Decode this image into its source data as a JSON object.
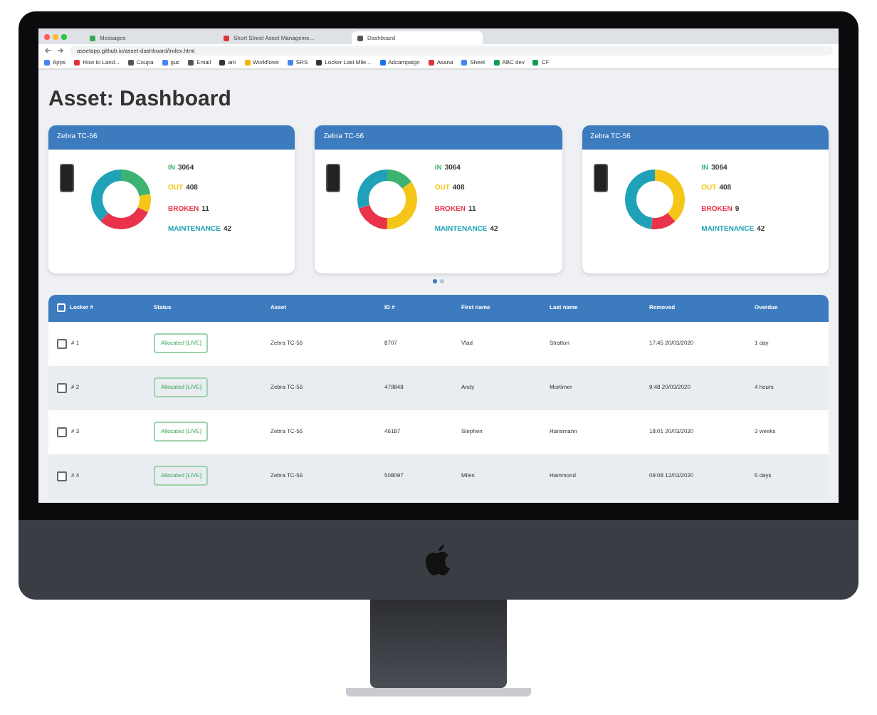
{
  "browser": {
    "tabs": [
      {
        "label": "Messages",
        "selected": false,
        "color": "#3aa757"
      },
      {
        "label": "Short Street Asset Manageme...",
        "selected": false,
        "color": "#e0323c"
      },
      {
        "label": "Dashboard",
        "selected": true,
        "color": "#555555"
      }
    ],
    "url": "assetapp.github.io/asset-dashboard/index.html",
    "bookmarks": [
      {
        "label": "Apps",
        "color": "#4285f4"
      },
      {
        "label": "How to Land...",
        "color": "#e0323c"
      },
      {
        "label": "Coupa",
        "color": "#555555"
      },
      {
        "label": "guc",
        "color": "#4285f4"
      },
      {
        "label": "Email",
        "color": "#555555"
      },
      {
        "label": "ani",
        "color": "#333333"
      },
      {
        "label": "Workflows",
        "color": "#f4b400"
      },
      {
        "label": "SRS",
        "color": "#4285f4"
      },
      {
        "label": "Locker Last Mile...",
        "color": "#333333"
      },
      {
        "label": "Adcampaign",
        "color": "#1a73e8"
      },
      {
        "label": "Asana",
        "color": "#e0323c"
      },
      {
        "label": "Sheet",
        "color": "#4285f4"
      },
      {
        "label": "ABC dev",
        "color": "#0f9d58"
      },
      {
        "label": "CF",
        "color": "#0f9d58"
      }
    ]
  },
  "page_title": "Asset: Dashboard",
  "cards": [
    {
      "title": "Zebra TC-56",
      "legend": [
        {
          "label": "IN",
          "count": "3064",
          "color": "#3cb371"
        },
        {
          "label": "OUT",
          "count": "408",
          "color": "#f5c518"
        },
        {
          "label": "BROKEN",
          "count": "11",
          "color": "#e8334a"
        },
        {
          "label": "MAINTENANCE",
          "count": "42",
          "color": "#1fa2b8"
        }
      ]
    },
    {
      "title": "Zebra TC-56",
      "legend": [
        {
          "label": "IN",
          "count": "3064",
          "color": "#3cb371"
        },
        {
          "label": "OUT",
          "count": "408",
          "color": "#f5c518"
        },
        {
          "label": "BROKEN",
          "count": "11",
          "color": "#e8334a"
        },
        {
          "label": "MAINTENANCE",
          "count": "42",
          "color": "#1fa2b8"
        }
      ]
    },
    {
      "title": "Zebra TC-56",
      "legend": [
        {
          "label": "IN",
          "count": "3064",
          "color": "#3cb371"
        },
        {
          "label": "OUT",
          "count": "408",
          "color": "#f5c518"
        },
        {
          "label": "BROKEN",
          "count": "9",
          "color": "#e8334a"
        },
        {
          "label": "MAINTENANCE",
          "count": "42",
          "color": "#1fa2b8"
        }
      ]
    }
  ],
  "carousel_dots": [
    {
      "selected": true
    },
    {
      "selected": false
    }
  ],
  "table": {
    "select_all_checked": false,
    "columns": [
      "Locker #",
      "Status",
      "Asset",
      "ID #",
      "First name",
      "Last name",
      "Removed",
      "Overdue"
    ],
    "rows": [
      {
        "checked": false,
        "cells": [
          "# 1",
          "Allocated [LIVE]",
          "Zebra TC-56",
          "8707",
          "Vlad",
          "Stratton",
          "17:45 20/03/2020",
          "1 day"
        ]
      },
      {
        "checked": false,
        "cells": [
          "# 2",
          "Allocated [LIVE]",
          "Zebra TC-56",
          "479848",
          "Andy",
          "Mortimer",
          "9:48 20/03/2020",
          "4 hours"
        ]
      },
      {
        "checked": false,
        "cells": [
          "# 3",
          "Allocated [LIVE]",
          "Zebra TC-56",
          "46187",
          "Stephen",
          "Hansmann",
          "18:01 20/03/2020",
          "3 weeks"
        ]
      },
      {
        "checked": false,
        "cells": [
          "# 4",
          "Allocated [LIVE]",
          "Zebra TC-56",
          "508097",
          "Miles",
          "Hammond",
          "09:08 12/03/2020",
          "5 days"
        ]
      }
    ]
  }
}
